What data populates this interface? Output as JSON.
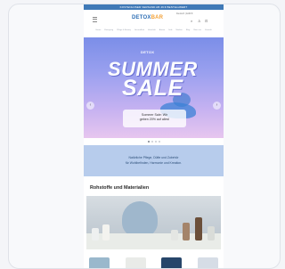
{
  "announcement": "KOSTENLOSER VERSAND AB 49 € BESTELLWERT",
  "header": {
    "logo_main": "DETOX",
    "logo_accent": "BAR",
    "language": "Deutsch | EUR €",
    "icons": [
      "menu-icon",
      "search-icon",
      "account-icon",
      "cart-icon"
    ]
  },
  "nav": {
    "items": [
      "Home",
      "Reinigung",
      "Pflege & Beauty",
      "Gesundheit",
      "Haushalt",
      "Aroma",
      "Sale",
      "Marken",
      "Blog",
      "Über uns",
      "Kontakt"
    ]
  },
  "hero": {
    "brand_tag": "DETOX",
    "headline_1": "SUMMER",
    "headline_2": "SALE",
    "promo_text": "Sommer Sale: Wir\ngeben 20% auf alles!",
    "prev_icon": "‹",
    "next_icon": "›"
  },
  "slider": {
    "count": 4,
    "active": 0
  },
  "info_band": "Natürliche Pflege, Düfte und Zubehör\nfür Wohlbefinden, Harmonie und Kreation.",
  "section": {
    "title": "Rohstoffe und Materialien"
  },
  "colors": {
    "announcement_bg": "#3f79b7",
    "info_band_bg": "#b7ccec",
    "hero_top": "#7b8ee8",
    "hero_bottom": "#e7c6ef"
  }
}
